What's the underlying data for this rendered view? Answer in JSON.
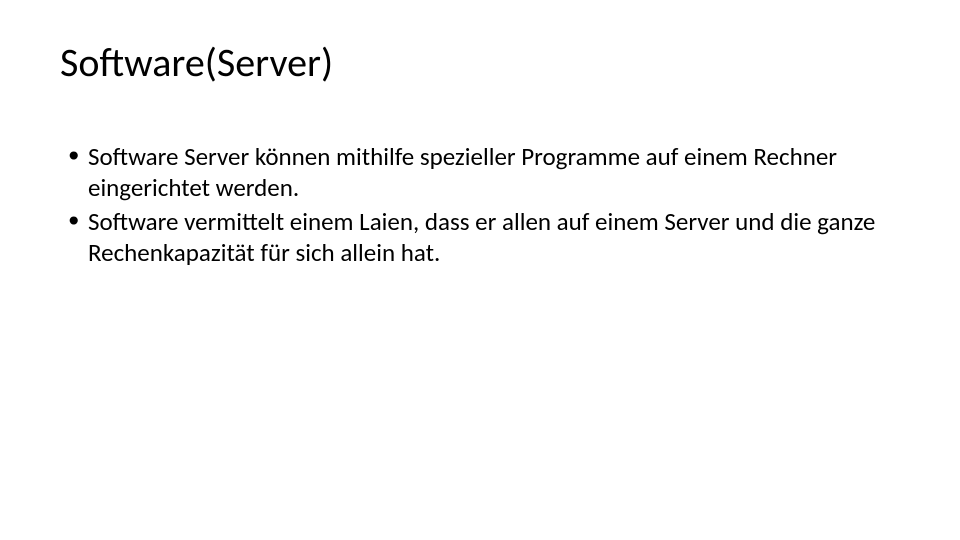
{
  "title": "Software(Server)",
  "bullets": [
    "Software Server können mithilfe spezieller Programme auf einem Rechner eingerichtet werden.",
    "Software vermittelt einem Laien, dass er allen auf einem Server und die ganze Rechenkapazität für sich allein hat."
  ]
}
